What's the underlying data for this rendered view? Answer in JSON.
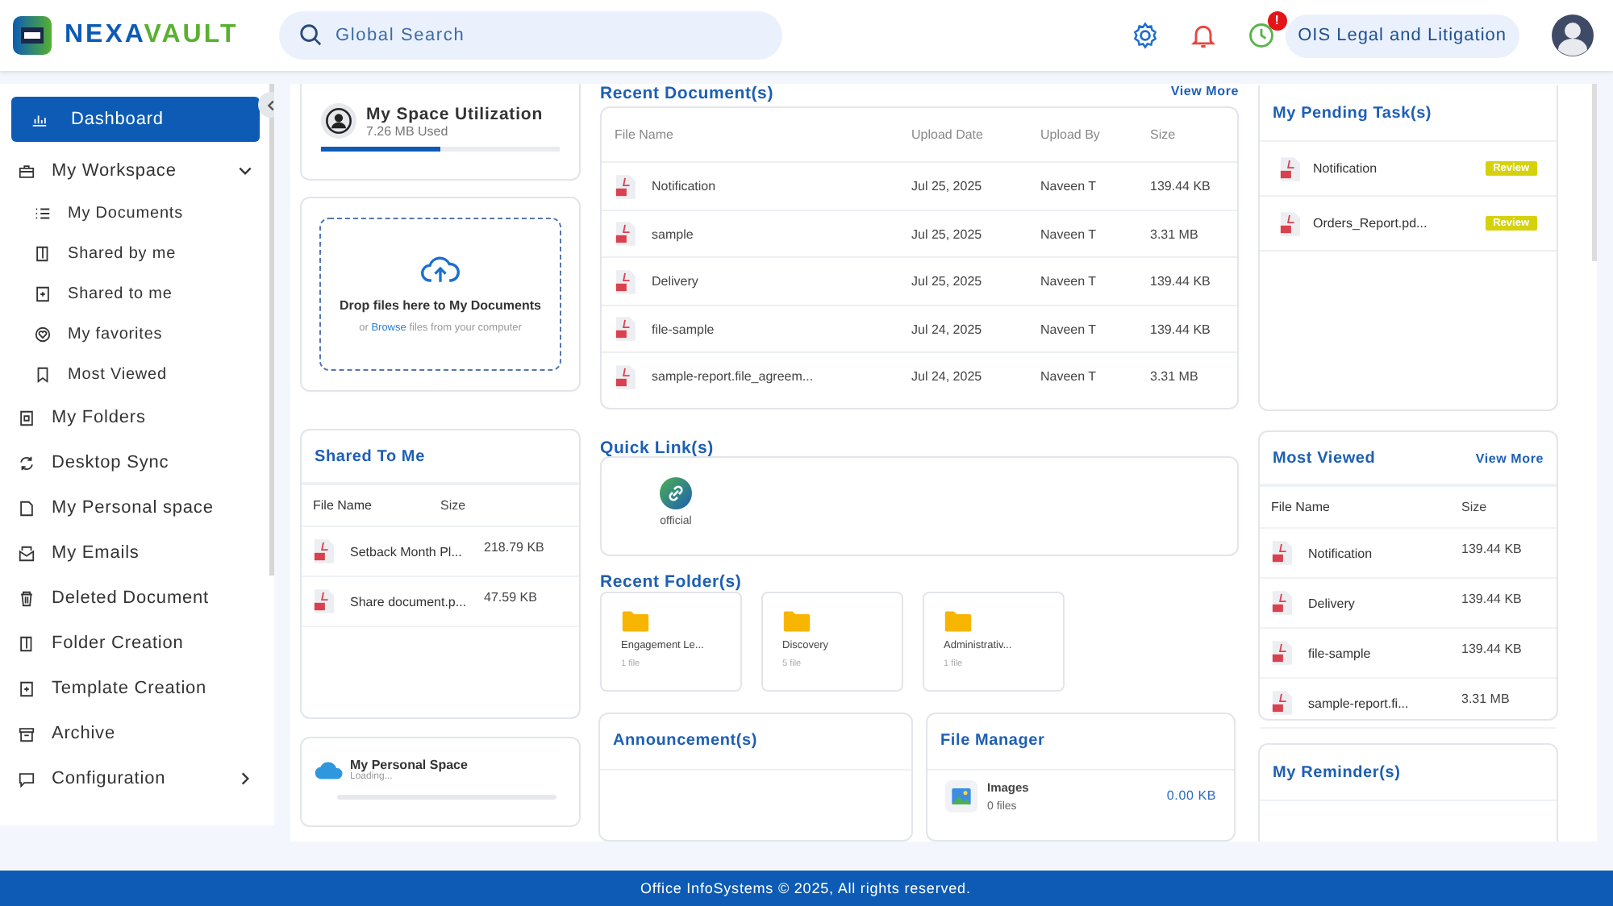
{
  "header": {
    "logo": {
      "part_1": "NEXA",
      "part_2": "VAULT"
    },
    "search": {
      "placeholder": "Global Search"
    },
    "reminder_badge": "!",
    "organization": "OIS Legal and Litigation"
  },
  "sidebar": {
    "items": [
      {
        "label": "Dashboard",
        "selected": true
      },
      {
        "label": "My Workspace",
        "selected": false,
        "expanded": true,
        "children": [
          {
            "label": "My Documents",
            "selected": false
          },
          {
            "label": "Shared by me",
            "selected": false
          },
          {
            "label": "Shared to me",
            "selected": false
          },
          {
            "label": "My favorites",
            "selected": false
          },
          {
            "label": "Most Viewed",
            "selected": false
          }
        ]
      },
      {
        "label": "My Folders",
        "selected": false
      },
      {
        "label": "Desktop Sync",
        "selected": false
      },
      {
        "label": "My Personal space",
        "selected": false
      },
      {
        "label": "My Emails",
        "selected": false
      },
      {
        "label": "Deleted Document",
        "selected": false
      },
      {
        "label": "Folder Creation",
        "selected": false
      },
      {
        "label": "Template Creation",
        "selected": false
      },
      {
        "label": "Archive",
        "selected": false
      },
      {
        "label": "Configuration",
        "selected": false,
        "expanded": false
      }
    ]
  },
  "space_utilization": {
    "title": "My Space Utilization",
    "used": "7.26 MB Used",
    "level": 0.5
  },
  "upload": {
    "title": "Drop files here to My Documents",
    "hint_before": "or",
    "link": "Browse",
    "hint_after": "files from your computer"
  },
  "shared_to_me": {
    "title": "Shared To Me",
    "columns": [
      "File Name",
      "Size"
    ],
    "rows": [
      {
        "name": "Setback Month Pl...",
        "size": "218.79 KB"
      },
      {
        "name": "Share document.p...",
        "size": "47.59 KB"
      }
    ]
  },
  "personal_space": {
    "title": "My Personal Space",
    "status": "Loading..."
  },
  "recent_documents": {
    "title": "Recent Document(s)",
    "view_more": "View More",
    "columns": [
      "File Name",
      "Upload Date",
      "Upload By",
      "Size"
    ],
    "rows": [
      {
        "name": "Notification",
        "date": "Jul 25, 2025",
        "by": "Naveen T",
        "size": "139.44 KB"
      },
      {
        "name": "sample",
        "date": "Jul 25, 2025",
        "by": "Naveen T",
        "size": "3.31 MB"
      },
      {
        "name": "Delivery",
        "date": "Jul 25, 2025",
        "by": "Naveen T",
        "size": "139.44 KB"
      },
      {
        "name": "file-sample",
        "date": "Jul 24, 2025",
        "by": "Naveen T",
        "size": "139.44 KB"
      },
      {
        "name": "sample-report.file_agreem...",
        "date": "Jul 24, 2025",
        "by": "Naveen T",
        "size": "3.31 MB"
      }
    ]
  },
  "quick_links": {
    "title": "Quick Link(s)",
    "items": [
      {
        "label": "official"
      }
    ]
  },
  "recent_folders": {
    "title": "Recent Folder(s)",
    "items": [
      {
        "name": "Engagement Le...",
        "count": "1 file"
      },
      {
        "name": "Discovery",
        "count": "5 file"
      },
      {
        "name": "Administrativ...",
        "count": "1 file"
      }
    ]
  },
  "announcements": {
    "title": "Announcement(s)"
  },
  "file_manager": {
    "title": "File Manager",
    "items": [
      {
        "name": "Images",
        "count": "0 files",
        "size": "0.00 KB"
      }
    ]
  },
  "pending_tasks": {
    "title": "My Pending Task(s)",
    "items": [
      {
        "name": "Notification",
        "status": "Review"
      },
      {
        "name": "Orders_Report.pd...",
        "status": "Review"
      }
    ]
  },
  "most_viewed": {
    "title": "Most Viewed",
    "view_more": "View More",
    "columns": [
      "File Name",
      "Size"
    ],
    "rows": [
      {
        "name": "Notification",
        "size": "139.44 KB"
      },
      {
        "name": "Delivery",
        "size": "139.44 KB"
      },
      {
        "name": "file-sample",
        "size": "139.44 KB"
      },
      {
        "name": "sample-report.fi...",
        "size": "3.31 MB"
      }
    ]
  },
  "reminders": {
    "title": "My Reminder(s)"
  },
  "footer": "Office InfoSystems © 2025, All rights reserved."
}
